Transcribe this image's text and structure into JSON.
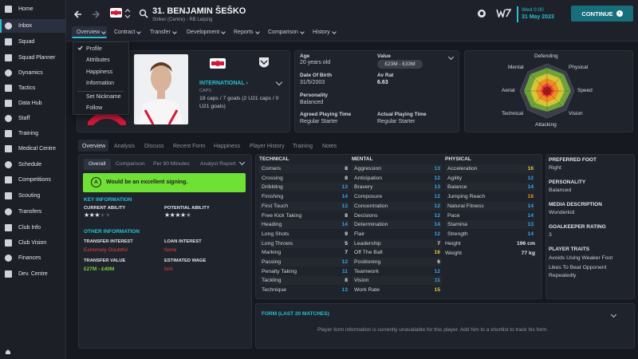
{
  "sidebar": {
    "items": [
      {
        "label": "Home",
        "icon": "home-icon"
      },
      {
        "label": "Inbox",
        "icon": "inbox-icon"
      },
      {
        "label": "Squad",
        "icon": "squad-icon"
      },
      {
        "label": "Squad Planner",
        "icon": "squad-planner-icon"
      },
      {
        "label": "Dynamics",
        "icon": "dynamics-icon"
      },
      {
        "label": "Tactics",
        "icon": "tactics-icon"
      },
      {
        "label": "Data Hub",
        "icon": "data-hub-icon"
      },
      {
        "label": "Staff",
        "icon": "staff-icon"
      },
      {
        "label": "Training",
        "icon": "training-icon"
      },
      {
        "label": "Medical Centre",
        "icon": "medical-icon"
      },
      {
        "label": "Schedule",
        "icon": "schedule-icon"
      },
      {
        "label": "Competitions",
        "icon": "trophy-icon"
      },
      {
        "label": "Scouting",
        "icon": "scouting-icon"
      },
      {
        "label": "Transfers",
        "icon": "transfers-icon"
      },
      {
        "label": "Club Info",
        "icon": "club-info-icon"
      },
      {
        "label": "Club Vision",
        "icon": "club-vision-icon"
      },
      {
        "label": "Finances",
        "icon": "finances-icon"
      },
      {
        "label": "Dev. Centre",
        "icon": "dev-centre-icon"
      }
    ]
  },
  "header": {
    "player_name": "31. BENJAMIN ŠEŠKO",
    "subtitle": "Striker (Centre) - RB Leipzig",
    "date_day": "Wed 0:00",
    "date": "31 May 2023",
    "continue_label": "CONTINUE"
  },
  "nav_tabs": [
    "Overview",
    "Contract",
    "Transfer",
    "Development",
    "Reports",
    "Comparison",
    "History"
  ],
  "dropdown": {
    "items": [
      "Profile",
      "Attributes",
      "Happiness",
      "Information",
      "Set Nickname",
      "Follow"
    ]
  },
  "profile": {
    "international_label": "INTERNATIONAL",
    "caps_label": "CAPS",
    "caps_text": "18 caps / 7 goals (2 U21 caps / 0 U21 goals)"
  },
  "info": {
    "age_label": "Age",
    "age_value": "20 years old",
    "value_label": "Value",
    "value_value": "£23M - £33M",
    "dob_label": "Date Of Birth",
    "dob_value": "31/5/2003",
    "avrat_label": "Av Rat",
    "avrat_value": "6.63",
    "personality_label": "Personality",
    "personality_value": "Balanced",
    "apt_label": "Agreed Playing Time",
    "apt_value": "Regular Starter",
    "actual_label": "Actual Playing Time",
    "actual_value": "Regular Starter"
  },
  "radar": {
    "labels": [
      "Defending",
      "Physical",
      "Speed",
      "Vision",
      "Attacking",
      "Technical",
      "Aerial",
      "Mental"
    ]
  },
  "sub_tabs": [
    "Overview",
    "Analysis",
    "Discuss",
    "Recent Form",
    "Happiness",
    "Player History",
    "Training",
    "Notes"
  ],
  "inner_tabs": [
    "Overall",
    "Comparison",
    "Per 90 Minutes",
    "Analyst Report"
  ],
  "recommendation": {
    "grade": "A",
    "text": "Would be an excellent signing."
  },
  "key_info": {
    "title": "KEY INFORMATION",
    "current_label": "CURRENT ABILITY",
    "potential_label": "POTENTIAL ABILITY",
    "current_stars": 3,
    "potential_stars": 4.5
  },
  "other_info": {
    "title": "OTHER INFORMATION",
    "transfer_interest_label": "TRANSFER INTEREST",
    "transfer_interest_value": "Extremely Doubtful",
    "loan_interest_label": "LOAN INTEREST",
    "loan_interest_value": "None",
    "transfer_value_label": "TRANSFER VALUE",
    "transfer_value_value": "£27M - £40M",
    "estimated_wage_label": "ESTIMATED WAGE",
    "estimated_wage_value": "N/A"
  },
  "technical": {
    "title": "TECHNICAL",
    "rows": [
      [
        "Corners",
        "8"
      ],
      [
        "Crossing",
        "8"
      ],
      [
        "Dribbling",
        "13"
      ],
      [
        "Finishing",
        "14"
      ],
      [
        "First Touch",
        "13"
      ],
      [
        "Free Kick Taking",
        "8"
      ],
      [
        "Heading",
        "14"
      ],
      [
        "Long Shots",
        "9"
      ],
      [
        "Long Throws",
        "5"
      ],
      [
        "Marking",
        "7"
      ],
      [
        "Passing",
        "12"
      ],
      [
        "Penalty Taking",
        "11"
      ],
      [
        "Tackling",
        "8"
      ],
      [
        "Technique",
        "13"
      ]
    ]
  },
  "mental": {
    "title": "MENTAL",
    "rows": [
      [
        "Aggression",
        "13"
      ],
      [
        "Anticipation",
        "12"
      ],
      [
        "Bravery",
        "13"
      ],
      [
        "Composure",
        "12"
      ],
      [
        "Concentration",
        "12"
      ],
      [
        "Decisions",
        "12"
      ],
      [
        "Determination",
        "14"
      ],
      [
        "Flair",
        "12"
      ],
      [
        "Leadership",
        "7"
      ],
      [
        "Off The Ball",
        "16"
      ],
      [
        "Positioning",
        "6"
      ],
      [
        "Teamwork",
        "12"
      ],
      [
        "Vision",
        "11"
      ],
      [
        "Work Rate",
        "15"
      ]
    ]
  },
  "physical": {
    "title": "PHYSICAL",
    "rows": [
      [
        "Acceleration",
        "16"
      ],
      [
        "Agility",
        "12"
      ],
      [
        "Balance",
        "14"
      ],
      [
        "Jumping Reach",
        "18"
      ],
      [
        "Natural Fitness",
        "14"
      ],
      [
        "Pace",
        "14"
      ],
      [
        "Stamina",
        "13"
      ],
      [
        "Strength",
        "14"
      ]
    ],
    "height_label": "Height",
    "height_value": "196 cm",
    "weight_label": "Weight",
    "weight_value": "77 kg"
  },
  "right_info": {
    "foot_label": "PREFERRED FOOT",
    "foot_value": "Right",
    "pers_label": "PERSONALITY",
    "pers_value": "Balanced",
    "media_label": "MEDIA DESCRIPTION",
    "media_value": "Wonderkid",
    "gk_label": "GOALKEEPER RATING",
    "gk_value": "3",
    "traits_label": "PLAYER TRAITS",
    "traits": [
      "Avoids Using Weaker Foot",
      "Likes To Beat Opponent Repeatedly"
    ]
  },
  "form": {
    "title": "FORM (LAST 20 MATCHES)",
    "message": "Player form information is currently unavailable for this player. Add him to a shortlist to track his form."
  },
  "colors": {
    "accent": "#25c2d3",
    "blue": "#35a3ea",
    "yellow": "#e6c634",
    "orange": "#f08b1f",
    "green": "#7ed23f",
    "red": "#e84141"
  }
}
